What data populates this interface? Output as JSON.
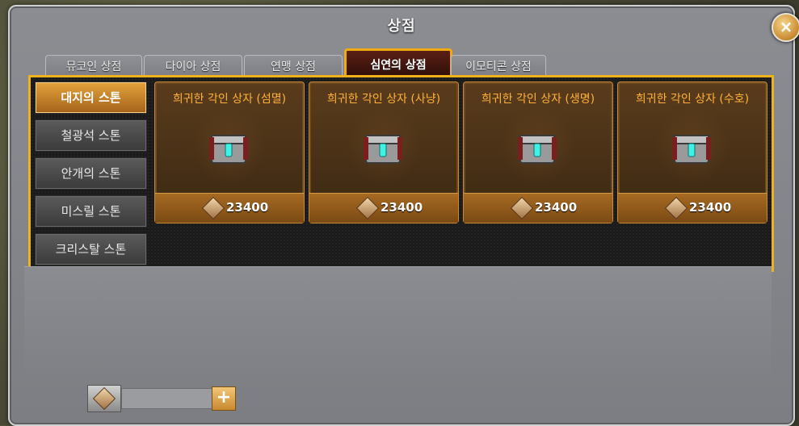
{
  "window": {
    "title": "상점",
    "close_icon": "×"
  },
  "tabs": [
    {
      "label": "뮤코인 상점",
      "active": false
    },
    {
      "label": "다이아 상점",
      "active": false
    },
    {
      "label": "연맹 상점",
      "active": false
    },
    {
      "label": "심연의 상점",
      "active": true
    },
    {
      "label": "이모티콘 상점",
      "active": false
    }
  ],
  "categories": [
    {
      "label": "대지의 스톤",
      "active": true
    },
    {
      "label": "철광석 스톤",
      "active": false
    },
    {
      "label": "안개의 스톤",
      "active": false
    },
    {
      "label": "미스릴 스톤",
      "active": false
    },
    {
      "label": "크리스탈 스톤",
      "active": false
    }
  ],
  "items": [
    {
      "title": "희귀한 각인 상자 (섬멸)",
      "price": "23400",
      "icon": "chest-icon",
      "currency_icon": "gem-icon"
    },
    {
      "title": "희귀한 각인 상자 (사냥)",
      "price": "23400",
      "icon": "chest-icon",
      "currency_icon": "gem-icon"
    },
    {
      "title": "희귀한 각인 상자 (생명)",
      "price": "23400",
      "icon": "chest-icon",
      "currency_icon": "gem-icon"
    },
    {
      "title": "희귀한 각인 상자 (수호)",
      "price": "23400",
      "icon": "chest-icon",
      "currency_icon": "gem-icon"
    }
  ],
  "footer": {
    "plus_label": "+"
  },
  "colors": {
    "accent": "#f0b21a",
    "price_bar": "#a66a22",
    "title_text": "#ffb13a"
  }
}
